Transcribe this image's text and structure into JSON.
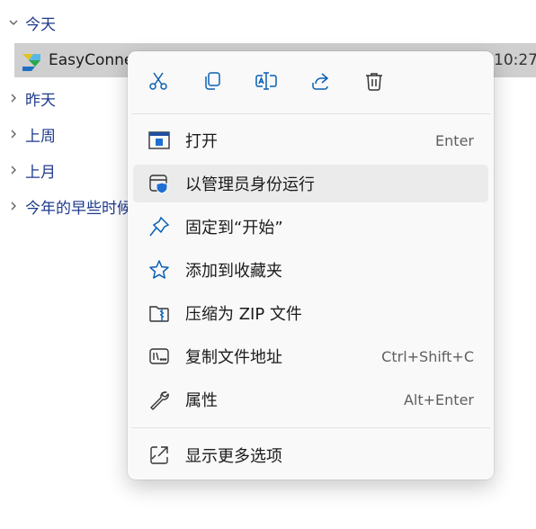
{
  "explorer": {
    "groups": [
      {
        "label": "今天",
        "expanded": true
      },
      {
        "label": "昨天",
        "expanded": false
      },
      {
        "label": "上周",
        "expanded": false
      },
      {
        "label": "上月",
        "expanded": false
      },
      {
        "label": "今年的早些时候",
        "expanded": false
      }
    ],
    "selected_file": {
      "name": "EasyConnect",
      "time": "10:27",
      "icon": "easyconnect-app-icon"
    }
  },
  "context_menu": {
    "quick_actions": [
      {
        "name": "cut",
        "icon": "scissors-icon"
      },
      {
        "name": "copy",
        "icon": "copy-icon"
      },
      {
        "name": "rename",
        "icon": "rename-icon"
      },
      {
        "name": "share",
        "icon": "share-icon"
      },
      {
        "name": "delete",
        "icon": "trash-icon"
      }
    ],
    "items": [
      {
        "label": "打开",
        "shortcut": "Enter",
        "icon": "app-window-icon"
      },
      {
        "label": "以管理员身份运行",
        "shortcut": "",
        "icon": "shield-icon",
        "highlighted": true
      },
      {
        "label": "固定到“开始”",
        "shortcut": "",
        "icon": "pin-icon"
      },
      {
        "label": "添加到收藏夹",
        "shortcut": "",
        "icon": "star-icon"
      },
      {
        "label": "压缩为 ZIP 文件",
        "shortcut": "",
        "icon": "zip-folder-icon"
      },
      {
        "label": "复制文件地址",
        "shortcut": "Ctrl+Shift+C",
        "icon": "copy-path-icon"
      },
      {
        "label": "属性",
        "shortcut": "Alt+Enter",
        "icon": "wrench-icon"
      },
      {
        "label": "显示更多选项",
        "shortcut": "",
        "icon": "more-options-icon"
      }
    ]
  },
  "colors": {
    "accent": "#005fb8",
    "group_text": "#1e3a8c",
    "menu_bg": "#f9f9f9",
    "hover": "#ebebeb"
  }
}
